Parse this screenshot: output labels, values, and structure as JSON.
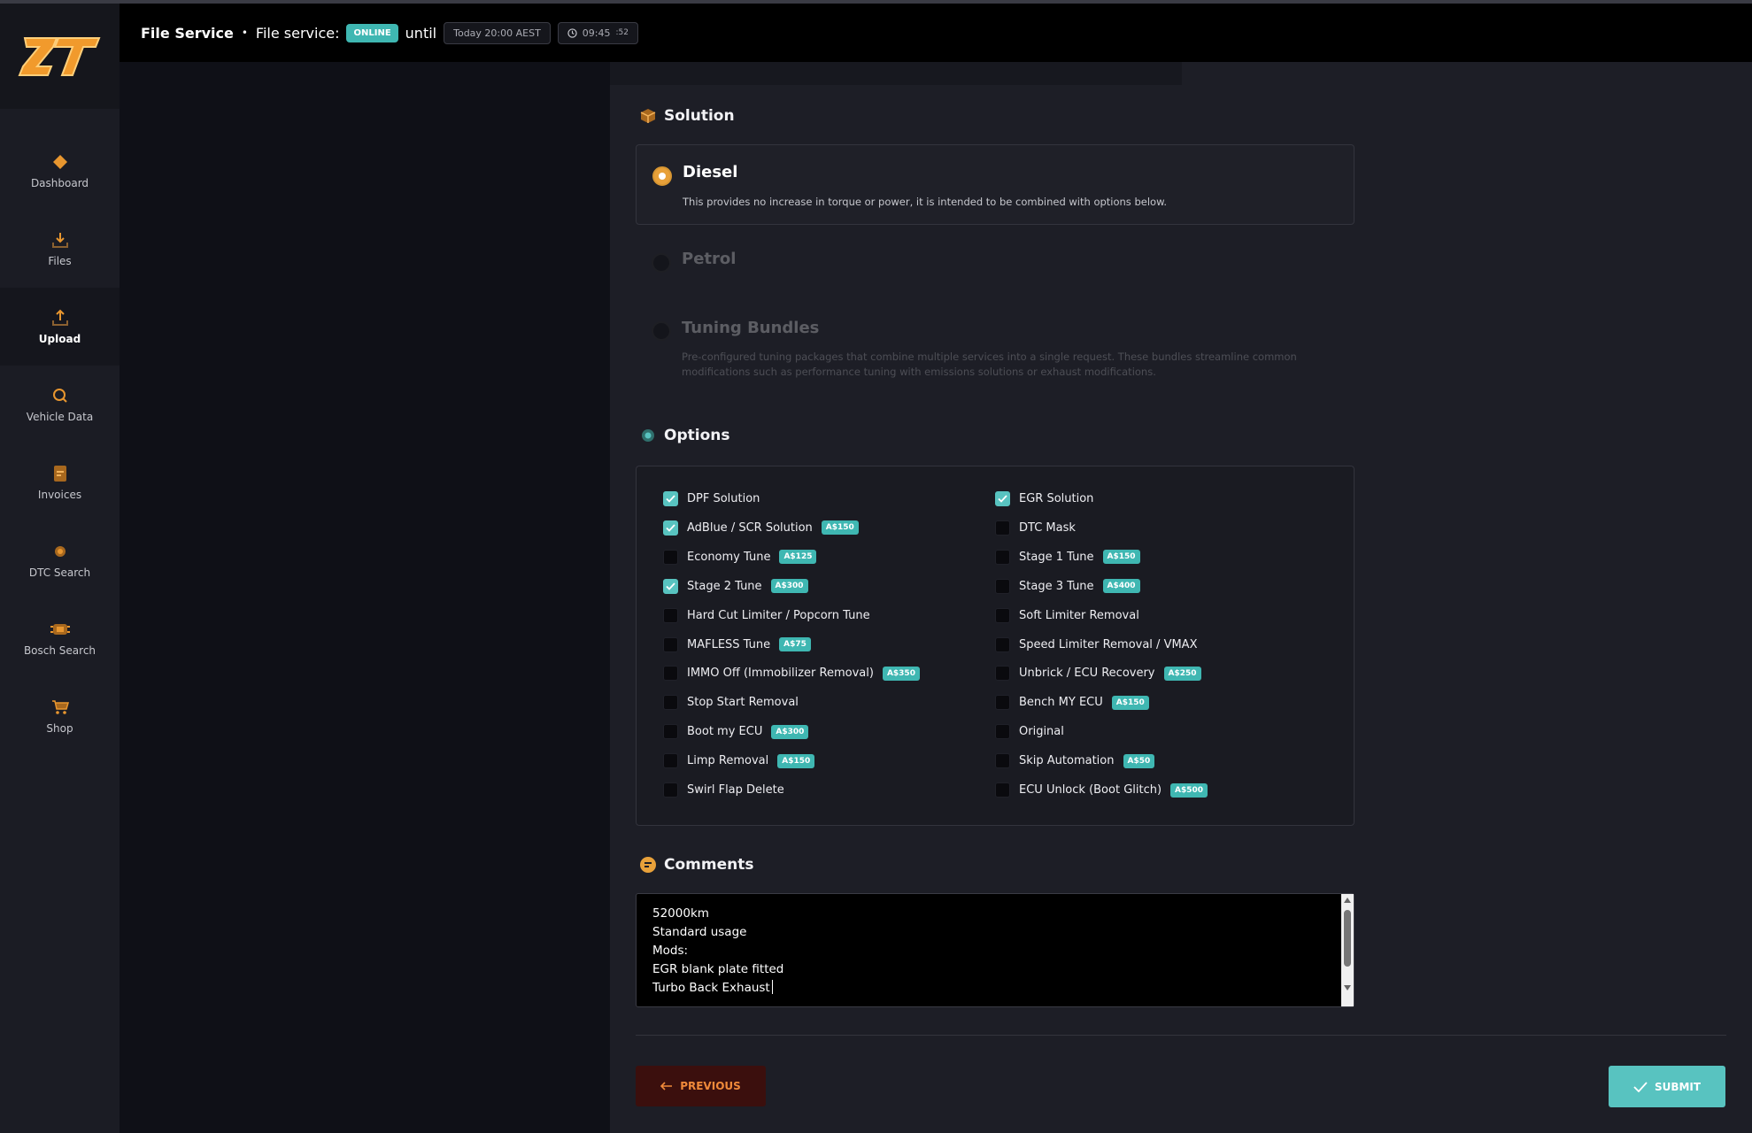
{
  "header": {
    "title": "File Service",
    "service_label": "File service:",
    "status": "ONLINE",
    "until": "until",
    "until_time": "Today 20:00 AEST",
    "clock_main": "09:45",
    "clock_sec": ":52"
  },
  "logo": "ZT",
  "sidebar": {
    "items": [
      {
        "label": "Dashboard",
        "icon": "dashboard-icon"
      },
      {
        "label": "Files",
        "icon": "files-download-icon"
      },
      {
        "label": "Upload",
        "icon": "upload-icon"
      },
      {
        "label": "Vehicle Data",
        "icon": "search-icon"
      },
      {
        "label": "Invoices",
        "icon": "invoice-icon"
      },
      {
        "label": "DTC Search",
        "icon": "gear-icon"
      },
      {
        "label": "Bosch Search",
        "icon": "chip-icon"
      },
      {
        "label": "Shop",
        "icon": "cart-icon"
      }
    ],
    "active": "Upload"
  },
  "solution": {
    "heading": "Solution",
    "options": [
      {
        "title": "Diesel",
        "desc": "This provides no increase in torque or power, it is intended to be combined with options below.",
        "selected": true
      },
      {
        "title": "Petrol",
        "desc": "",
        "selected": false
      },
      {
        "title": "Tuning Bundles",
        "desc": "Pre-configured tuning packages that combine multiple services into a single request. These bundles streamline common modifications such as performance tuning with emissions solutions or exhaust modifications.",
        "selected": false
      }
    ]
  },
  "options": {
    "heading": "Options",
    "left": [
      {
        "label": "DPF Solution",
        "price": "",
        "checked": true
      },
      {
        "label": "AdBlue / SCR Solution",
        "price": "A$150",
        "checked": true
      },
      {
        "label": "Economy Tune",
        "price": "A$125",
        "checked": false
      },
      {
        "label": "Stage 2 Tune",
        "price": "A$300",
        "checked": true
      },
      {
        "label": "Hard Cut Limiter / Popcorn Tune",
        "price": "",
        "checked": false
      },
      {
        "label": "MAFLESS Tune",
        "price": "A$75",
        "checked": false
      },
      {
        "label": "IMMO Off (Immobilizer Removal)",
        "price": "A$350",
        "checked": false
      },
      {
        "label": "Stop Start Removal",
        "price": "",
        "checked": false
      },
      {
        "label": "Boot my ECU",
        "price": "A$300",
        "checked": false
      },
      {
        "label": "Limp Removal",
        "price": "A$150",
        "checked": false
      },
      {
        "label": "Swirl Flap Delete",
        "price": "",
        "checked": false
      }
    ],
    "right": [
      {
        "label": "EGR Solution",
        "price": "",
        "checked": true
      },
      {
        "label": "DTC Mask",
        "price": "",
        "checked": false
      },
      {
        "label": "Stage 1 Tune",
        "price": "A$150",
        "checked": false
      },
      {
        "label": "Stage 3 Tune",
        "price": "A$400",
        "checked": false
      },
      {
        "label": "Soft Limiter Removal",
        "price": "",
        "checked": false
      },
      {
        "label": "Speed Limiter Removal / VMAX",
        "price": "",
        "checked": false
      },
      {
        "label": "Unbrick / ECU Recovery",
        "price": "A$250",
        "checked": false
      },
      {
        "label": "Bench MY ECU",
        "price": "A$150",
        "checked": false
      },
      {
        "label": "Original",
        "price": "",
        "checked": false
      },
      {
        "label": "Skip Automation",
        "price": "A$50",
        "checked": false
      },
      {
        "label": "ECU Unlock (Boot Glitch)",
        "price": "A$500",
        "checked": false
      }
    ]
  },
  "comments": {
    "heading": "Comments",
    "value": "52000km\nStandard usage\nMods:\nEGR blank plate fitted\nTurbo Back Exhaust"
  },
  "buttons": {
    "previous": "PREVIOUS",
    "submit": "SUBMIT"
  },
  "colors": {
    "accent_orange": "#e8a13a",
    "accent_teal": "#58c3c0",
    "badge_teal": "#3fb7b2",
    "prev_bg": "#3b0f0d"
  }
}
